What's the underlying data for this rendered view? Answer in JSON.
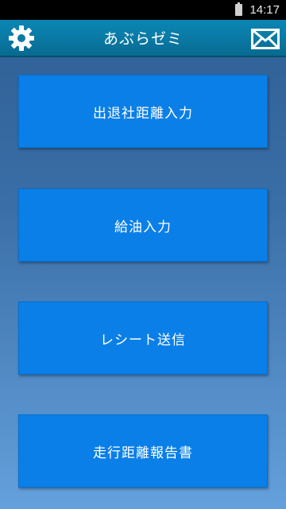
{
  "status_bar": {
    "time": "14:17"
  },
  "app_bar": {
    "title": "あぶらゼミ",
    "settings_icon": "gear-icon",
    "mail_icon": "envelope-icon"
  },
  "menu": {
    "buttons": [
      {
        "label": "出退社距離入力"
      },
      {
        "label": "給油入力"
      },
      {
        "label": "レシート送信"
      },
      {
        "label": "走行距離報告書"
      }
    ]
  },
  "colors": {
    "app_bar": "#0a7aa5",
    "button": "#0a7fe8",
    "background_top": "#2e5f94",
    "background_bottom": "#64a0dc"
  }
}
